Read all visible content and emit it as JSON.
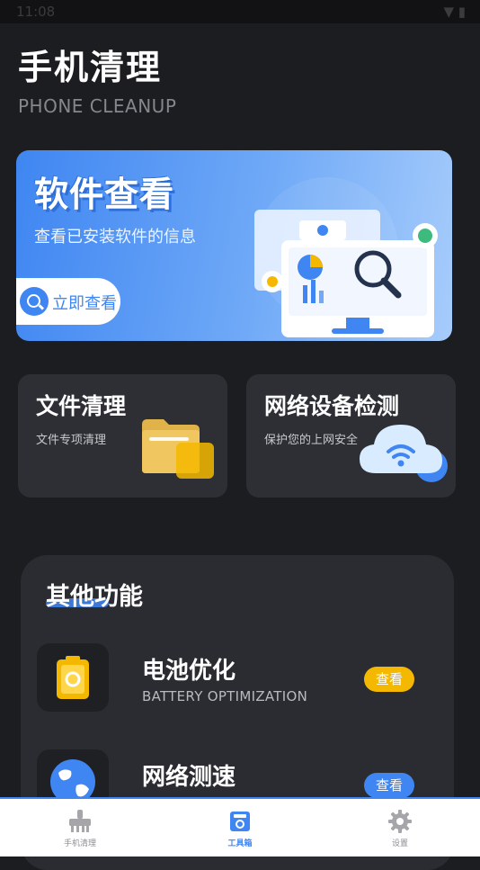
{
  "status_bar": {
    "time": "11:08",
    "icons": "▼ ▮"
  },
  "header": {
    "title": "手机清理",
    "subtitle": "PHONE CLEANUP"
  },
  "banner": {
    "title": "软件查看",
    "description": "查看已安装软件的信息",
    "button_label": "立即查看"
  },
  "cards": [
    {
      "title": "文件清理",
      "subtitle": "文件专项清理"
    },
    {
      "title": "网络设备检测",
      "subtitle": "保护您的上网安全"
    }
  ],
  "other_features": {
    "title": "其他功能",
    "items": [
      {
        "name": "电池优化",
        "name_en": "BATTERY OPTIMIZATION",
        "button": "查看",
        "button_color": "#f5b800"
      },
      {
        "name": "网络测速",
        "name_en": "",
        "button": "查看",
        "button_color": "#3f86f2"
      }
    ]
  },
  "bottom_nav": [
    {
      "label": "手机清理",
      "icon": "broom-icon",
      "active": false
    },
    {
      "label": "工具箱",
      "icon": "toolbox-icon",
      "active": true
    },
    {
      "label": "设置",
      "icon": "gear-icon",
      "active": false
    }
  ],
  "colors": {
    "accent": "#3f86f2",
    "battery_button": "#f5b800",
    "background": "#1c1d20"
  }
}
